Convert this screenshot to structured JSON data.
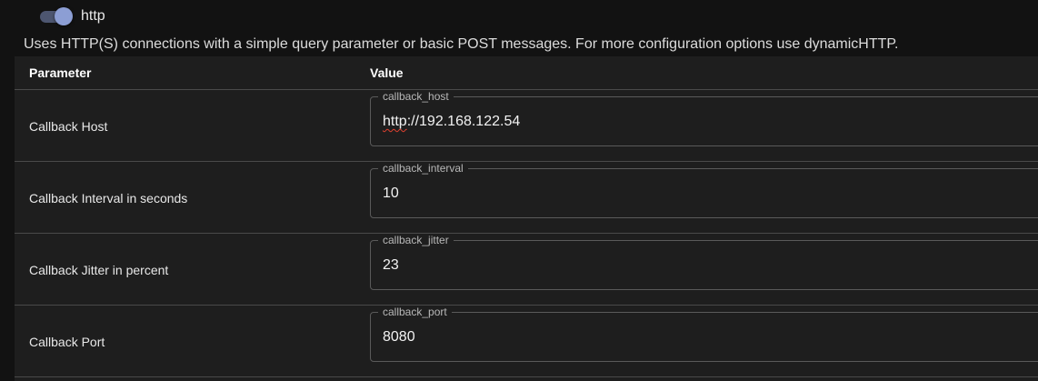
{
  "profile": {
    "name": "http",
    "enabled": true,
    "description": "Uses HTTP(S) connections with a simple query parameter or basic POST messages. For more configuration options use dynamicHTTP."
  },
  "table": {
    "headers": {
      "parameter": "Parameter",
      "value": "Value"
    },
    "rows": [
      {
        "label": "Callback Host",
        "field_name": "callback_host",
        "value_scheme": "http",
        "value_rest": "://192.168.122.54"
      },
      {
        "label": "Callback Interval in seconds",
        "field_name": "callback_interval",
        "value": "10"
      },
      {
        "label": "Callback Jitter in percent",
        "field_name": "callback_jitter",
        "value": "23"
      },
      {
        "label": "Callback Port",
        "field_name": "callback_port",
        "value": "8080"
      }
    ]
  },
  "colors": {
    "background": "#121212",
    "panel": "#1e1e1e",
    "toggle_thumb": "#8c9ed4",
    "toggle_track": "#4d5670",
    "divider": "#4a4a4a",
    "field_border": "#5a5a5a"
  }
}
